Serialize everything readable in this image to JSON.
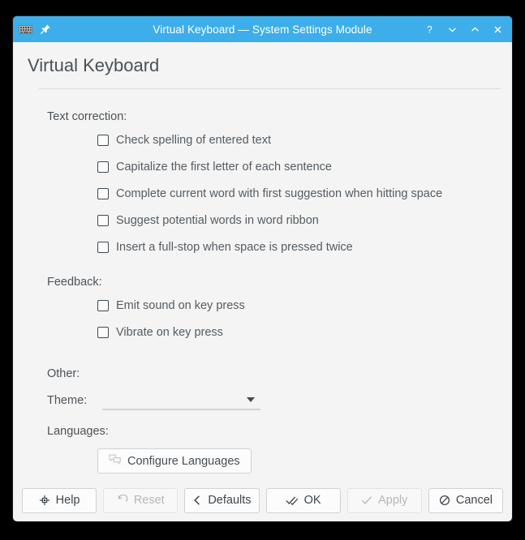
{
  "window": {
    "titlebar": {
      "title": "Virtual Keyboard — System Settings Module",
      "app_icon": "keyboard-icon",
      "pin_icon": "pin-icon",
      "help_label": "?",
      "minimize_label": "⌄",
      "maximize_label": "⌃",
      "close_label": "✕",
      "accent_color": "#3daee9",
      "title_color": "#ffffff"
    },
    "header": {
      "page_title": "Virtual Keyboard"
    },
    "background_color": "#f4f4f4"
  },
  "sections": {
    "text_correction": {
      "label": "Text correction:",
      "checkboxes": [
        {
          "label": "Check spelling of entered text",
          "checked": false
        },
        {
          "label": "Capitalize the first letter of each sentence",
          "checked": false
        },
        {
          "label": "Complete current word with first suggestion when hitting space",
          "checked": false
        },
        {
          "label": "Suggest potential words in word ribbon",
          "checked": false
        },
        {
          "label": "Insert a full-stop when space is pressed twice",
          "checked": false
        }
      ]
    },
    "feedback": {
      "label": "Feedback:",
      "checkboxes": [
        {
          "label": "Emit sound on key press",
          "checked": false
        },
        {
          "label": "Vibrate on key press",
          "checked": false
        }
      ]
    },
    "other": {
      "label": "Other:",
      "theme": {
        "label": "Theme:",
        "value": "",
        "placeholder": "",
        "caret_icon": "chevron-down-icon"
      }
    },
    "languages": {
      "label": "Languages:",
      "configure_button": {
        "label": "Configure Languages",
        "icon": "languages-icon"
      }
    }
  },
  "footer": {
    "buttons": [
      {
        "label": "Help",
        "icon": "help-icon",
        "enabled": true
      },
      {
        "label": "Reset",
        "icon": "reset-icon",
        "enabled": false
      },
      {
        "label": "Defaults",
        "icon": "defaults-icon",
        "enabled": true
      },
      {
        "label": "OK",
        "icon": "ok-icon",
        "enabled": true
      },
      {
        "label": "Apply",
        "icon": "apply-icon",
        "enabled": false
      },
      {
        "label": "Cancel",
        "icon": "cancel-icon",
        "enabled": true
      }
    ]
  }
}
